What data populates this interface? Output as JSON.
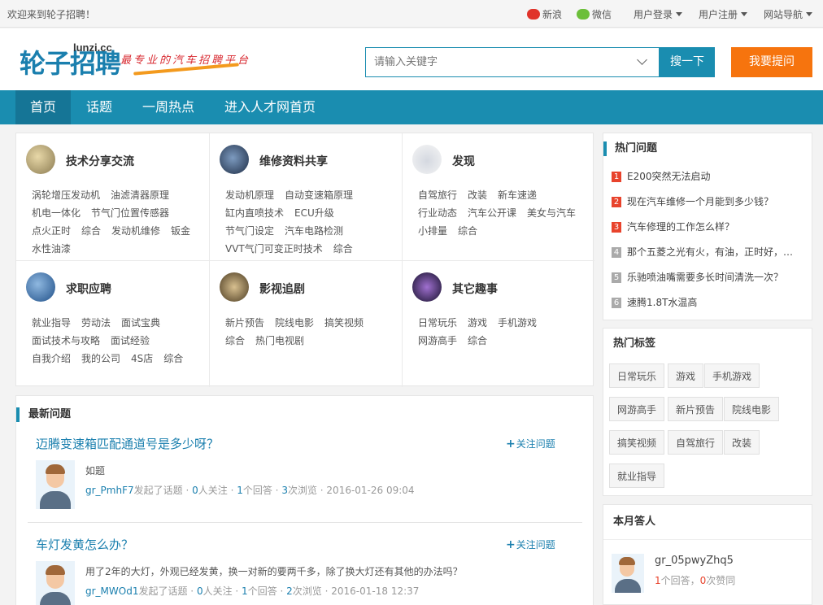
{
  "topbar": {
    "welcome": "欢迎来到轮子招聘！",
    "weibo": "新浪",
    "weixin": "微信",
    "login": "用户登录",
    "register": "用户注册",
    "sitenav": "网站导航"
  },
  "logo": {
    "main": "轮子招聘",
    "domain": "lunzi.cc",
    "slogan": "最专业的汽车招聘平台"
  },
  "search": {
    "placeholder": "请输入关键字",
    "button": "搜一下",
    "ask_button": "我要提问"
  },
  "nav": [
    "首页",
    "话题",
    "一周热点",
    "进入人才网首页"
  ],
  "categories": [
    {
      "title": "技术分享交流",
      "tags": [
        "涡轮增压发动机",
        "油滤清器原理",
        "机电一体化",
        "节气门位置传感器",
        "点火正时",
        "综合",
        "发动机维修",
        "钣金",
        "水性油漆"
      ]
    },
    {
      "title": "维修资料共享",
      "tags": [
        "发动机原理",
        "自动变速箱原理",
        "缸内直喷技术",
        "ECU升级",
        "节气门设定",
        "汽车电路检测",
        "VVT气门可变正时技术",
        "综合"
      ]
    },
    {
      "title": "发现",
      "tags": [
        "自驾旅行",
        "改装",
        "新车速递",
        "行业动态",
        "汽车公开课",
        "美女与汽车",
        "小排量",
        "综合"
      ]
    },
    {
      "title": "求职应聘",
      "tags": [
        "就业指导",
        "劳动法",
        "面试宝典",
        "面试技术与攻略",
        "面试经验",
        "自我介绍",
        "我的公司",
        "4S店",
        "综合"
      ]
    },
    {
      "title": "影视追剧",
      "tags": [
        "新片预告",
        "院线电影",
        "搞笑视频",
        "综合",
        "热门电视剧"
      ]
    },
    {
      "title": "其它趣事",
      "tags": [
        "日常玩乐",
        "游戏",
        "手机游戏",
        "网游高手",
        "综合"
      ]
    }
  ],
  "latest": {
    "heading": "最新问题",
    "follow_label": "关注问题",
    "questions": [
      {
        "title": "迈腾变速箱匹配通道号是多少呀？",
        "text": "如题",
        "user": "gr_PmhF7",
        "action": "发起了话题",
        "followers": "0",
        "followers_label": "人关注",
        "answers": "1",
        "answers_label": "个回答",
        "views": "3",
        "views_label": "次浏览",
        "date": "2016-01-26 09:04"
      },
      {
        "title": "车灯发黄怎么办？",
        "text": "用了2年的大灯，外观已经发黄，换一对新的要两千多，除了换大灯还有其他的办法吗？",
        "user": "gr_MWOd1",
        "action": "发起了话题",
        "followers": "0",
        "followers_label": "人关注",
        "answers": "1",
        "answers_label": "个回答",
        "views": "2",
        "views_label": "次浏览",
        "date": "2016-01-18 12:37"
      }
    ]
  },
  "hot": {
    "heading": "热门问题",
    "items": [
      {
        "rank": "1",
        "text": "E200突然无法启动"
      },
      {
        "rank": "2",
        "text": "现在汽车维修一个月能到多少钱？"
      },
      {
        "rank": "3",
        "text": "汽车修理的工作怎么样？"
      },
      {
        "rank": "4",
        "text": "那个五菱之光有火，有油，正时好，…"
      },
      {
        "rank": "5",
        "text": "乐驰喷油嘴需要多长时间清洗一次？"
      },
      {
        "rank": "6",
        "text": "速腾1.8T水温高"
      }
    ]
  },
  "tags_box": {
    "heading": "热门标签",
    "tags": [
      "日常玩乐",
      "游戏",
      "手机游戏",
      "网游高手",
      "新片预告",
      "院线电影",
      "搞笑视频",
      "自驾旅行",
      "改装",
      "就业指导"
    ]
  },
  "answerers": {
    "heading": "本月答人",
    "user": "gr_05pwyZhq5",
    "answers": "1",
    "answers_label": "个回答，",
    "likes": "0",
    "likes_label": "次赞同"
  },
  "colors": {
    "primary": "#1a8db0",
    "accent": "#f6740e",
    "rank_hot": "#e8432c"
  }
}
